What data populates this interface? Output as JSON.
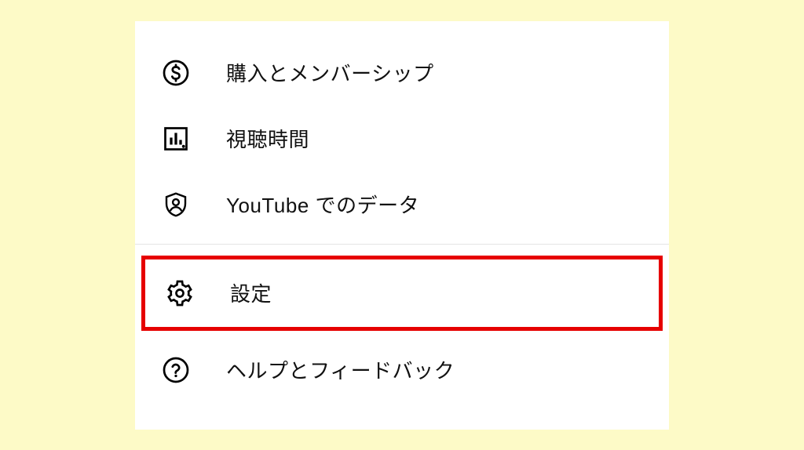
{
  "menu": {
    "section1": [
      {
        "icon": "dollar-circle-icon",
        "label": "購入とメンバーシップ"
      },
      {
        "icon": "bar-chart-box-icon",
        "label": "視聴時間"
      },
      {
        "icon": "person-shield-icon",
        "label": "YouTube でのデータ"
      }
    ],
    "highlighted": {
      "icon": "gear-icon",
      "label": "設定"
    },
    "section2": [
      {
        "icon": "help-circle-icon",
        "label": "ヘルプとフィードバック"
      }
    ]
  },
  "highlight_color": "#e60000"
}
